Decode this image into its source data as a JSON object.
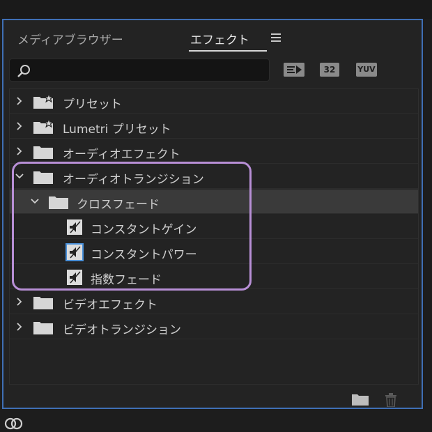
{
  "tabs": {
    "media_browser": "メディアブラウザー",
    "effects": "エフェクト"
  },
  "search": {
    "value": "",
    "placeholder": ""
  },
  "filters": {
    "accelerated": "",
    "bit32": "32",
    "yuv": "YUV"
  },
  "tree": {
    "items": [
      {
        "label": "プリセット",
        "kind": "star-folder",
        "expanded": false,
        "level": 0
      },
      {
        "label": "Lumetri プリセット",
        "kind": "star-folder",
        "expanded": false,
        "level": 0
      },
      {
        "label": "オーディオエフェクト",
        "kind": "folder",
        "expanded": false,
        "level": 0
      },
      {
        "label": "オーディオトランジション",
        "kind": "folder",
        "expanded": true,
        "level": 0
      },
      {
        "label": "クロスフェード",
        "kind": "folder",
        "expanded": true,
        "level": 1,
        "selected": true
      },
      {
        "label": "コンスタントゲイン",
        "kind": "audio-transition",
        "level": 2
      },
      {
        "label": "コンスタントパワー",
        "kind": "audio-transition",
        "level": 2,
        "default": true
      },
      {
        "label": "指数フェード",
        "kind": "audio-transition",
        "level": 2
      },
      {
        "label": "ビデオエフェクト",
        "kind": "folder",
        "expanded": false,
        "level": 0
      },
      {
        "label": "ビデオトランジション",
        "kind": "folder",
        "expanded": false,
        "level": 0
      }
    ]
  },
  "colors": {
    "panel_border": "#3f6fb5",
    "highlight_annotation": "#b88fd6",
    "selected_row": "#3a3a3a"
  }
}
